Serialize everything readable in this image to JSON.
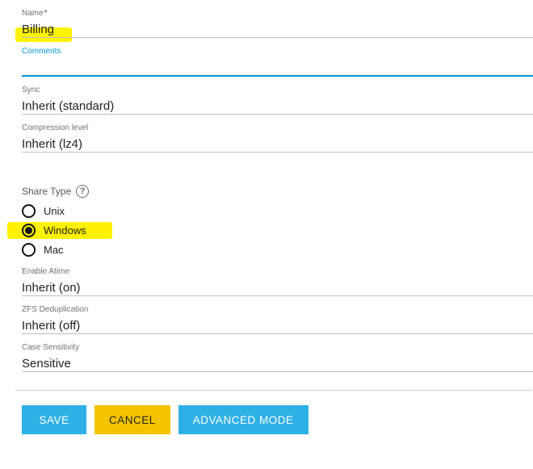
{
  "fields": {
    "name": {
      "label": "Name",
      "required_mark": "*",
      "value": "Billing"
    },
    "comments": {
      "label": "Comments",
      "value": ""
    },
    "sync": {
      "label": "Sync",
      "value": "Inherit (standard)"
    },
    "compression": {
      "label": "Compression level",
      "value": "Inherit (lz4)"
    },
    "atime": {
      "label": "Enable Atime",
      "value": "Inherit (on)"
    },
    "dedup": {
      "label": "ZFS Deduplication",
      "value": "Inherit (off)"
    },
    "casesens": {
      "label": "Case Sensitivity",
      "value": "Sensitive"
    }
  },
  "share_type": {
    "label": "Share Type",
    "help_glyph": "?",
    "options": [
      {
        "label": "Unix",
        "selected": false
      },
      {
        "label": "Windows",
        "selected": true
      },
      {
        "label": "Mac",
        "selected": false
      }
    ]
  },
  "actions": {
    "save": "SAVE",
    "cancel": "CANCEL",
    "adv": "ADVANCED MODE"
  }
}
